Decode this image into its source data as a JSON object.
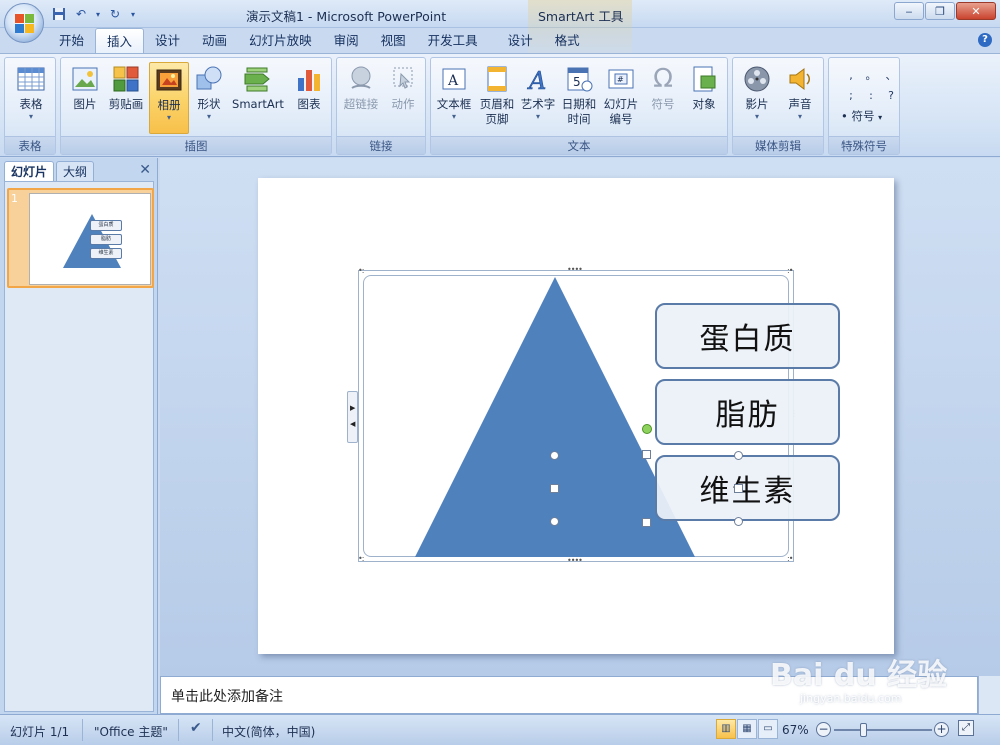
{
  "window": {
    "title": "演示文稿1 - Microsoft PowerPoint",
    "contextual_title": "SmartArt 工具"
  },
  "tabs": [
    "开始",
    "插入",
    "设计",
    "动画",
    "幻灯片放映",
    "审阅",
    "视图",
    "开发工具",
    "设计",
    "格式"
  ],
  "ribbon": {
    "groups": {
      "table": "表格",
      "illustrations": "插图",
      "links": "链接",
      "text": "文本",
      "media": "媒体剪辑",
      "special": "特殊符号"
    },
    "buttons": {
      "table": "表格",
      "picture": "图片",
      "clipart": "剪贴画",
      "album": "相册",
      "shapes": "形状",
      "smartart": "SmartArt",
      "chart": "图表",
      "hyperlink": "超链接",
      "action": "动作",
      "textbox": "文本框",
      "header_footer_1": "页眉和",
      "header_footer_2": "页脚",
      "wordart": "艺术字",
      "datetime_1": "日期和",
      "datetime_2": "时间",
      "slide_number_1": "幻灯片",
      "slide_number_2": "编号",
      "symbol": "符号",
      "object": "对象",
      "movie": "影片",
      "sound": "声音",
      "symbol_dd": "符号"
    },
    "symbols": [
      ",",
      "。",
      "、",
      ";",
      ":",
      "?"
    ]
  },
  "left_pane": {
    "tab_slides": "幻灯片",
    "tab_outline": "大纲",
    "slide_number": "1",
    "thumb_labels": [
      "蛋白质",
      "脂肪",
      "维生素"
    ]
  },
  "slide": {
    "items": [
      "蛋白质",
      "脂肪",
      "维生素"
    ]
  },
  "notes": {
    "placeholder": "单击此处添加备注"
  },
  "status": {
    "slide_info": "幻灯片 1/1",
    "theme": "\"Office 主题\"",
    "language": "中文(简体，中国)",
    "zoom": "67%",
    "zoom_level_percent": 67
  },
  "watermark": {
    "brand": "Bai du 经验",
    "url": "jingyan.baidu.com"
  },
  "colors": {
    "pyramid": "#4f81bd",
    "selection_tab": "#f8c04a"
  }
}
